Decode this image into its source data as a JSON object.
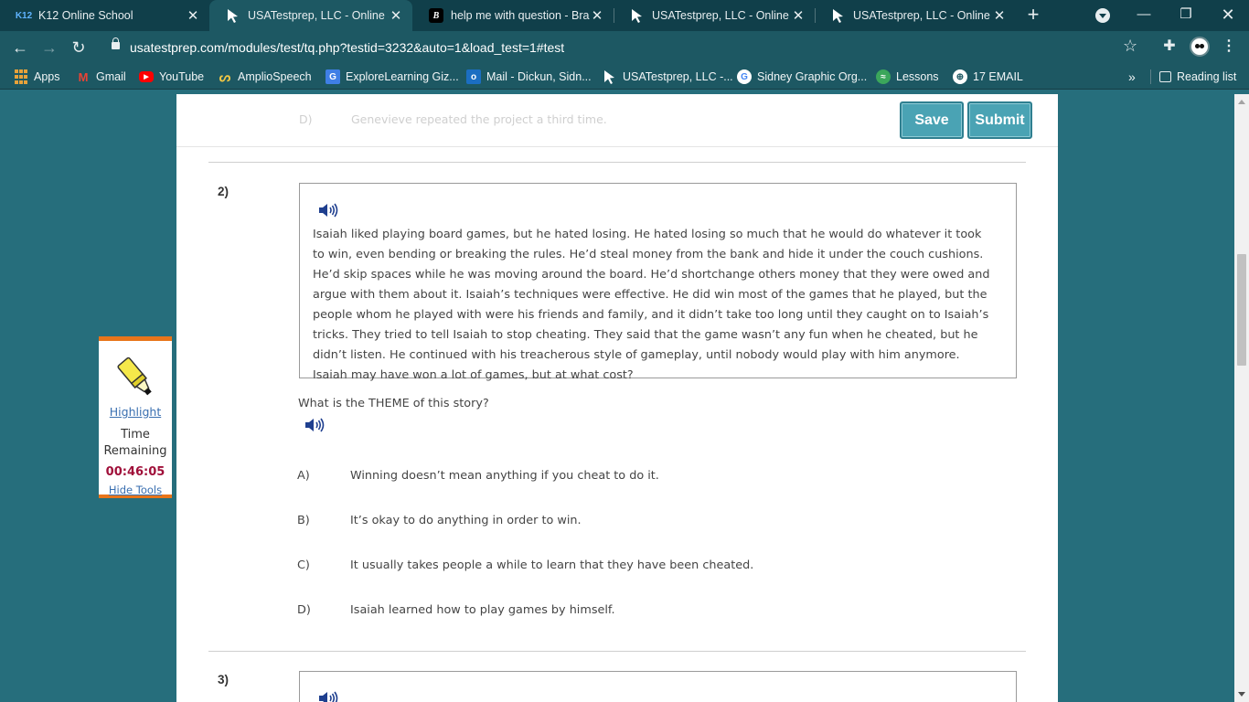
{
  "browser": {
    "tabs": [
      {
        "title": "K12 Online School",
        "favicon": "k12-logo",
        "favicon_text": "K12",
        "active": false
      },
      {
        "title": "USATestprep, LLC - Online Sta",
        "favicon": "usatestprep-cursor",
        "active": true
      },
      {
        "title": "help me with question - Brain",
        "favicon": "brainly-logo",
        "favicon_text": "B",
        "active": false
      },
      {
        "title": "USATestprep, LLC - Online Sta",
        "favicon": "usatestprep-cursor",
        "active": false
      },
      {
        "title": "USATestprep, LLC - Online Sta",
        "favicon": "usatestprep-cursor",
        "active": false
      }
    ],
    "url": "usatestprep.com/modules/test/tq.php?testid=3232&auto=1&load_test=1#test",
    "bookmarks": [
      {
        "label": "Apps",
        "icon": "apps-grid-icon"
      },
      {
        "label": "Gmail",
        "icon": "gmail-icon",
        "glyph": "M"
      },
      {
        "label": "YouTube",
        "icon": "youtube-icon",
        "glyph": "▶"
      },
      {
        "label": "AmplioSpeech",
        "icon": "ampliospeech-icon",
        "glyph": "ᔕ"
      },
      {
        "label": "ExploreLearning Giz...",
        "icon": "explorelearning-icon",
        "glyph": "G"
      },
      {
        "label": "Mail - Dickun, Sidn...",
        "icon": "outlook-icon",
        "glyph": "o"
      },
      {
        "label": "USATestprep, LLC -...",
        "icon": "usatestprep-icon"
      },
      {
        "label": "Sidney Graphic Org...",
        "icon": "google-icon",
        "glyph": "G"
      },
      {
        "label": "Lessons",
        "icon": "lessons-icon",
        "glyph": "≈"
      },
      {
        "label": "17 EMAIL",
        "icon": "globe-icon",
        "glyph": "⊕"
      }
    ],
    "reading_list": "Reading list",
    "more_bookmarks": "»"
  },
  "page": {
    "previous_answer": {
      "letter": "D)",
      "text": "Genevieve repeated the project a third time."
    },
    "save_label": "Save",
    "submit_label": "Submit",
    "question2": {
      "number": "2)",
      "passage": "Isaiah liked playing board games, but he hated losing. He hated losing so much that he would do whatever it took to win, even bending or breaking the rules. He’d steal money from the bank and hide it under the couch cushions. He’d skip spaces while he was moving around the board. He’d shortchange others money that they were owed and argue with them about it. Isaiah’s techniques were effective. He did win most of the games that he played, but the people whom he played with were his friends and family, and it didn’t take too long until they caught on to Isaiah’s tricks. They tried to tell Isaiah to stop cheating. They said that the game wasn’t any fun when he cheated, but he didn’t listen. He continued with his treacherous style of gameplay, until nobody would play with him anymore. Isaiah may have won a lot of games, but at what cost?",
      "prompt": "What is the THEME of this story?",
      "choices": [
        {
          "letter": "A)",
          "text": "Winning doesn’t mean anything if you cheat to do it."
        },
        {
          "letter": "B)",
          "text": "It’s okay to do anything in order to win."
        },
        {
          "letter": "C)",
          "text": "It usually takes people a while to learn that they have been cheated."
        },
        {
          "letter": "D)",
          "text": "Isaiah learned how to play games by himself."
        }
      ]
    },
    "question3": {
      "number": "3)"
    }
  },
  "tools": {
    "highlight_label": "Highlight",
    "time_label": "Time Remaining",
    "time_value": "00:46:05",
    "hide_tools_label": "Hide Tools"
  },
  "colors": {
    "page_background": "#266e7c",
    "button": "#4aa3b4",
    "tools_border": "#e8751a",
    "timer": "#a0103a"
  }
}
